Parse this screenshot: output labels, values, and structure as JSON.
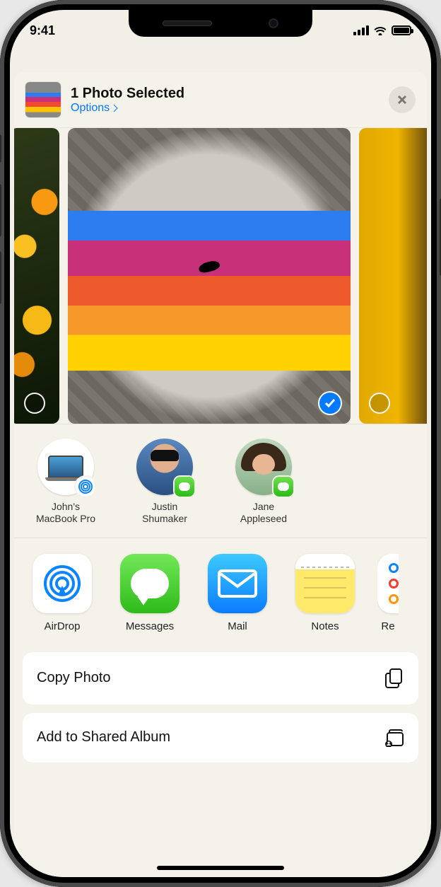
{
  "statusbar": {
    "time": "9:41"
  },
  "header": {
    "title": "1 Photo Selected",
    "options_label": "Options"
  },
  "photos": {
    "selected_index": 1
  },
  "contacts": [
    {
      "name_line1": "John's",
      "name_line2": "MacBook Pro",
      "type": "airdrop"
    },
    {
      "name_line1": "Justin",
      "name_line2": "Shumaker",
      "type": "messages"
    },
    {
      "name_line1": "Jane",
      "name_line2": "Appleseed",
      "type": "messages"
    }
  ],
  "apps": [
    {
      "label": "AirDrop"
    },
    {
      "label": "Messages"
    },
    {
      "label": "Mail"
    },
    {
      "label": "Notes"
    },
    {
      "label": "Re"
    }
  ],
  "actions": [
    {
      "label": "Copy Photo"
    },
    {
      "label": "Add to Shared Album"
    }
  ]
}
